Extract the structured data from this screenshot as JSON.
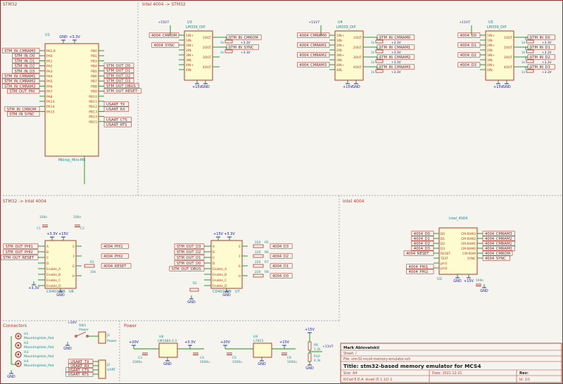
{
  "sections": {
    "stm32": "STM32",
    "intel_to_stm": "Intel 4004 -> STM32",
    "stm_to_intel": "STM32 -> Intel 4004",
    "intel": "Intel 4004",
    "connectors": "Connectors",
    "power": "Power"
  },
  "u1": {
    "ref": "U1",
    "value": "Mikrop_Mini-Mk",
    "top_pins": [
      "GND",
      "+3.3V"
    ],
    "left_pins": [
      "MCLR",
      "PA0",
      "PA1",
      "PA2",
      "PA3",
      "PA4",
      "PA5",
      "PA6",
      "PA7",
      "PA8",
      "PA13",
      "PA14",
      "PA15"
    ],
    "right_pins": [
      "PB0",
      "PB1",
      "PB3",
      "PB4",
      "PB5",
      "PB6",
      "PB7",
      "PB8",
      "PB9",
      "PB10",
      "PB11",
      "PB12",
      "PB13",
      "PB14",
      "PB15"
    ],
    "left_labels": [
      "STM_IN_CMRAM0",
      "STM_IN_D0",
      "STM_IN_D1",
      "STM_IN_D2",
      "STM_IN_D3",
      "STM_IN_CMRAM1",
      "STM_IN_CMRAM2",
      "STM_IN_CMRAM3",
      "STM_OUT_PHI",
      "STM_IN_CMROM",
      "STM_IN_SYNC"
    ],
    "right_labels": [
      "STM_OUT_D0",
      "STM_OUT_D1",
      "STM_OUT_D2",
      "STM_OUT_D3",
      "STM_OUT_DBUS",
      "STM_OUT_RESET",
      "USART_TX",
      "USART_RX",
      "USART_CTS",
      "USART_RTS"
    ]
  },
  "comparators": {
    "u3": {
      "ref": "U3",
      "value": "LM339_DIP",
      "inputs": [
        "4004_CMROM",
        "4004_SYNC"
      ],
      "outputs": [
        "STM_IN_CMROM",
        "STM_IN_SYNC"
      ],
      "resistors": [
        "R1",
        "R2"
      ],
      "rail": "+15V7"
    },
    "u4": {
      "ref": "U4",
      "value": "LM339_DIP",
      "inputs": [
        "4004_CMRAM0",
        "4004_CMRAM1",
        "4004_CMRAM2",
        "4004_CMRAM3"
      ],
      "outputs": [
        "STM_IN_CMRAM0",
        "STM_IN_CMRAM1",
        "STM_IN_CMRAM2",
        "STM_IN_CMRAM3"
      ],
      "resistors": [
        "R3",
        "R4",
        "R5",
        "R6"
      ],
      "rail": "+11V7"
    },
    "u5": {
      "ref": "U5",
      "value": "LM339_DIP",
      "inputs": [
        "4004_D0",
        "4004_D1",
        "4004_D2",
        "4004_D3"
      ],
      "outputs": [
        "STM_IN_D0",
        "STM_IN_D1",
        "STM_IN_D2",
        "STM_IN_D3"
      ],
      "resistors": [
        "R15",
        "R16",
        "R17",
        "R18"
      ],
      "rail": "+11V7"
    },
    "pin_in": [
      "1IN+",
      "1IN-",
      "2IN+",
      "2IN-",
      "3IN+",
      "3IN-",
      "4IN+",
      "4IN-"
    ],
    "pin_out": [
      "1OUT",
      "2OUT",
      "3OUT",
      "4OUT"
    ],
    "supply": [
      "+15V",
      "GND"
    ],
    "pullup": "+3.3V",
    "res_value": "1k"
  },
  "shifters": {
    "u6": {
      "ref": "U6",
      "value": "CD40109B",
      "inputs": [
        "STM_OUT_PHI1",
        "STM_OUT_PHI2",
        "STM_OUT_RESET"
      ],
      "outputs": [
        "4004_PHI1",
        "4004_PHI2",
        "4004_RESET"
      ],
      "rails": [
        "+3.3V",
        "+15V"
      ],
      "caps": [
        "C1",
        "C2"
      ],
      "cap_value": "100n",
      "res": "R1",
      "res_value": "10k"
    },
    "u7": {
      "ref": "U7",
      "value": "CD40109B",
      "inputs": [
        "STM_OUT_D3",
        "STM_OUT_D2",
        "STM_OUT_D1",
        "STM_OUT_D0",
        "STM_OUT_DBUS"
      ],
      "outputs": [
        "4004_D3",
        "4004_D2",
        "4004_D1",
        "4004_D0"
      ],
      "rails": [
        "+15V",
        "+3.3V"
      ],
      "resistors": [
        "R5",
        "R6",
        "R7",
        "R8"
      ],
      "res_value": "220",
      "pulldown": "R2"
    },
    "pin_left": [
      "A",
      "B",
      "C",
      "D",
      "Enable_A",
      "Enable_B",
      "Enable_C",
      "Enable_D"
    ],
    "pin_right": [
      "E",
      "F",
      "G",
      "H"
    ],
    "gnd": "GND"
  },
  "u2": {
    "ref": "U2",
    "value": "Intel_4004",
    "left_pins": [
      "D0",
      "D1",
      "D2",
      "D3",
      "RESET",
      "TEST",
      "phi1",
      "phi2"
    ],
    "right_pins": [
      "CM-RAM3",
      "CM-RAM2",
      "CM-RAM1",
      "CM-RAM0",
      "CM-ROM",
      "SYNC"
    ],
    "left_labels": [
      "4004_D0",
      "4004_D1",
      "4004_D2",
      "4004_D3",
      "4004_RESET",
      "4004_PHI1",
      "4004_PHI2"
    ],
    "right_labels": [
      "4004_CMRAM3",
      "4004_CMRAM2",
      "4004_CMRAM1",
      "4004_CMRAM0",
      "4004_CMROM",
      "4004_SYNC"
    ],
    "power": [
      "GND",
      "+15V",
      "GND"
    ],
    "cap": "100n"
  },
  "connectors": {
    "holes": [
      {
        "ref": "H1",
        "label": "MountingHole_Pad"
      },
      {
        "ref": "H2",
        "label": "MountingHole_Pad"
      },
      {
        "ref": "H3",
        "label": "MountingHole_Pad"
      },
      {
        "ref": "H4",
        "label": "MountingHole_Pad"
      }
    ],
    "sw": {
      "ref": "SW1",
      "label": "Power"
    },
    "j1": {
      "ref": "J1",
      "label": "Power",
      "net": "+20V"
    },
    "j2": {
      "ref": "J2",
      "label": "UART",
      "pins": [
        "USART_TX",
        "USART_RX",
        "USART_CTS",
        "USART_RTS"
      ]
    }
  },
  "power": {
    "u8": {
      "ref": "U8",
      "value": "LM1084-3.3",
      "in": "+20V",
      "out": "+3.3V"
    },
    "u9": {
      "ref": "U9",
      "value": "L7815",
      "in": "+20V",
      "out": "+15V"
    },
    "caps": [
      {
        "ref": "C3",
        "value": "1000u"
      },
      {
        "ref": "C4",
        "value": "1000u"
      },
      {
        "ref": "C5",
        "value": "1000u"
      },
      {
        "ref": "C6",
        "value": "1000u"
      }
    ],
    "divider": [
      {
        "ref": "R9",
        "value": "1.2k"
      },
      {
        "ref": "R10",
        "value": "4.3k"
      }
    ],
    "div_out": "+11V7",
    "gnd": "GND"
  },
  "title_block": {
    "author": "Mark Ablovatskii",
    "sheet": "Sheet: /",
    "file": "File: stm32-mcs4-memory-emulator.sch",
    "title": "Title: stm32-based memory emulator for MCS4",
    "size": "Size: A4",
    "date": "Date: 2021-12-21",
    "rev": "Rev:",
    "tool": "KiCad E.D.A.  kicad (5.1.12)-1",
    "id": "Id: 1/1"
  }
}
